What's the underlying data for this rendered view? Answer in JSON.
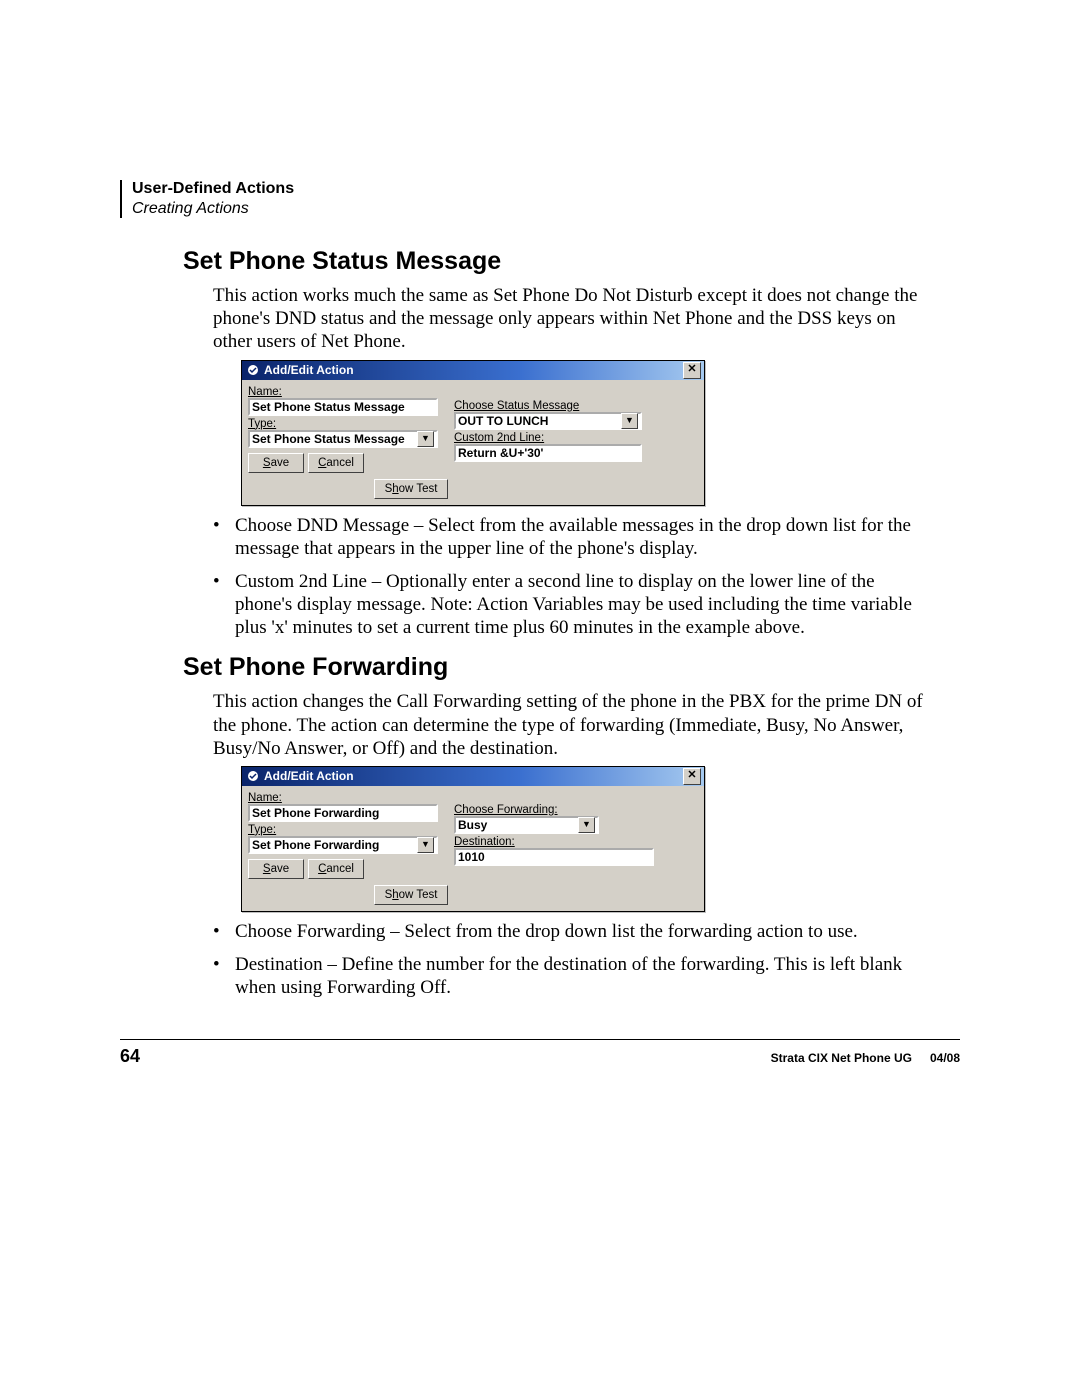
{
  "header": {
    "title": "User-Defined Actions",
    "subtitle": "Creating Actions"
  },
  "section1": {
    "heading": "Set Phone Status Message",
    "intro": "This action works much the same as Set Phone Do Not Disturb except it does not change the phone's DND status and the message only appears within Net Phone and the DSS keys on other users of Net Phone.",
    "bullets": [
      "Choose DND Message – Select from the available messages in the drop down list for the message that appears in the upper line of the phone's display.",
      "Custom 2nd Line – Optionally enter a second line to display on the lower line of the phone's display message.  Note:  Action Variables may be used including the time variable plus 'x' minutes to set a current time plus 60 minutes in the example above."
    ]
  },
  "dialog1": {
    "title": "Add/Edit Action",
    "name_label": "Name:",
    "name_value": "Set Phone Status Message",
    "type_label": "Type:",
    "type_value": "Set Phone Status Message",
    "save": "Save",
    "cancel": "Cancel",
    "showtest": "Show Test",
    "msg_label": "Choose Status Message",
    "msg_value": "OUT TO LUNCH",
    "custom_label": "Custom 2nd Line:",
    "custom_value": "Return &U+'30'"
  },
  "section2": {
    "heading": "Set Phone Forwarding",
    "intro": "This action changes the Call Forwarding setting of the phone in the PBX for the prime DN of the phone.  The action can determine the type of forwarding (Immediate, Busy, No Answer, Busy/No Answer, or Off) and the destination.",
    "bullets": [
      "Choose Forwarding – Select from the drop down list the forwarding action to use.",
      "Destination – Define the number for the destination of the forwarding.  This is left blank when using Forwarding Off."
    ]
  },
  "dialog2": {
    "title": "Add/Edit Action",
    "name_label": "Name:",
    "name_value": "Set Phone Forwarding",
    "type_label": "Type:",
    "type_value": "Set Phone Forwarding",
    "save": "Save",
    "cancel": "Cancel",
    "showtest": "Show Test",
    "fwd_label": "Choose Forwarding:",
    "fwd_value": "Busy",
    "dest_label": "Destination:",
    "dest_value": "1010"
  },
  "footer": {
    "page": "64",
    "doc": "Strata CIX Net Phone UG",
    "date": "04/08"
  }
}
